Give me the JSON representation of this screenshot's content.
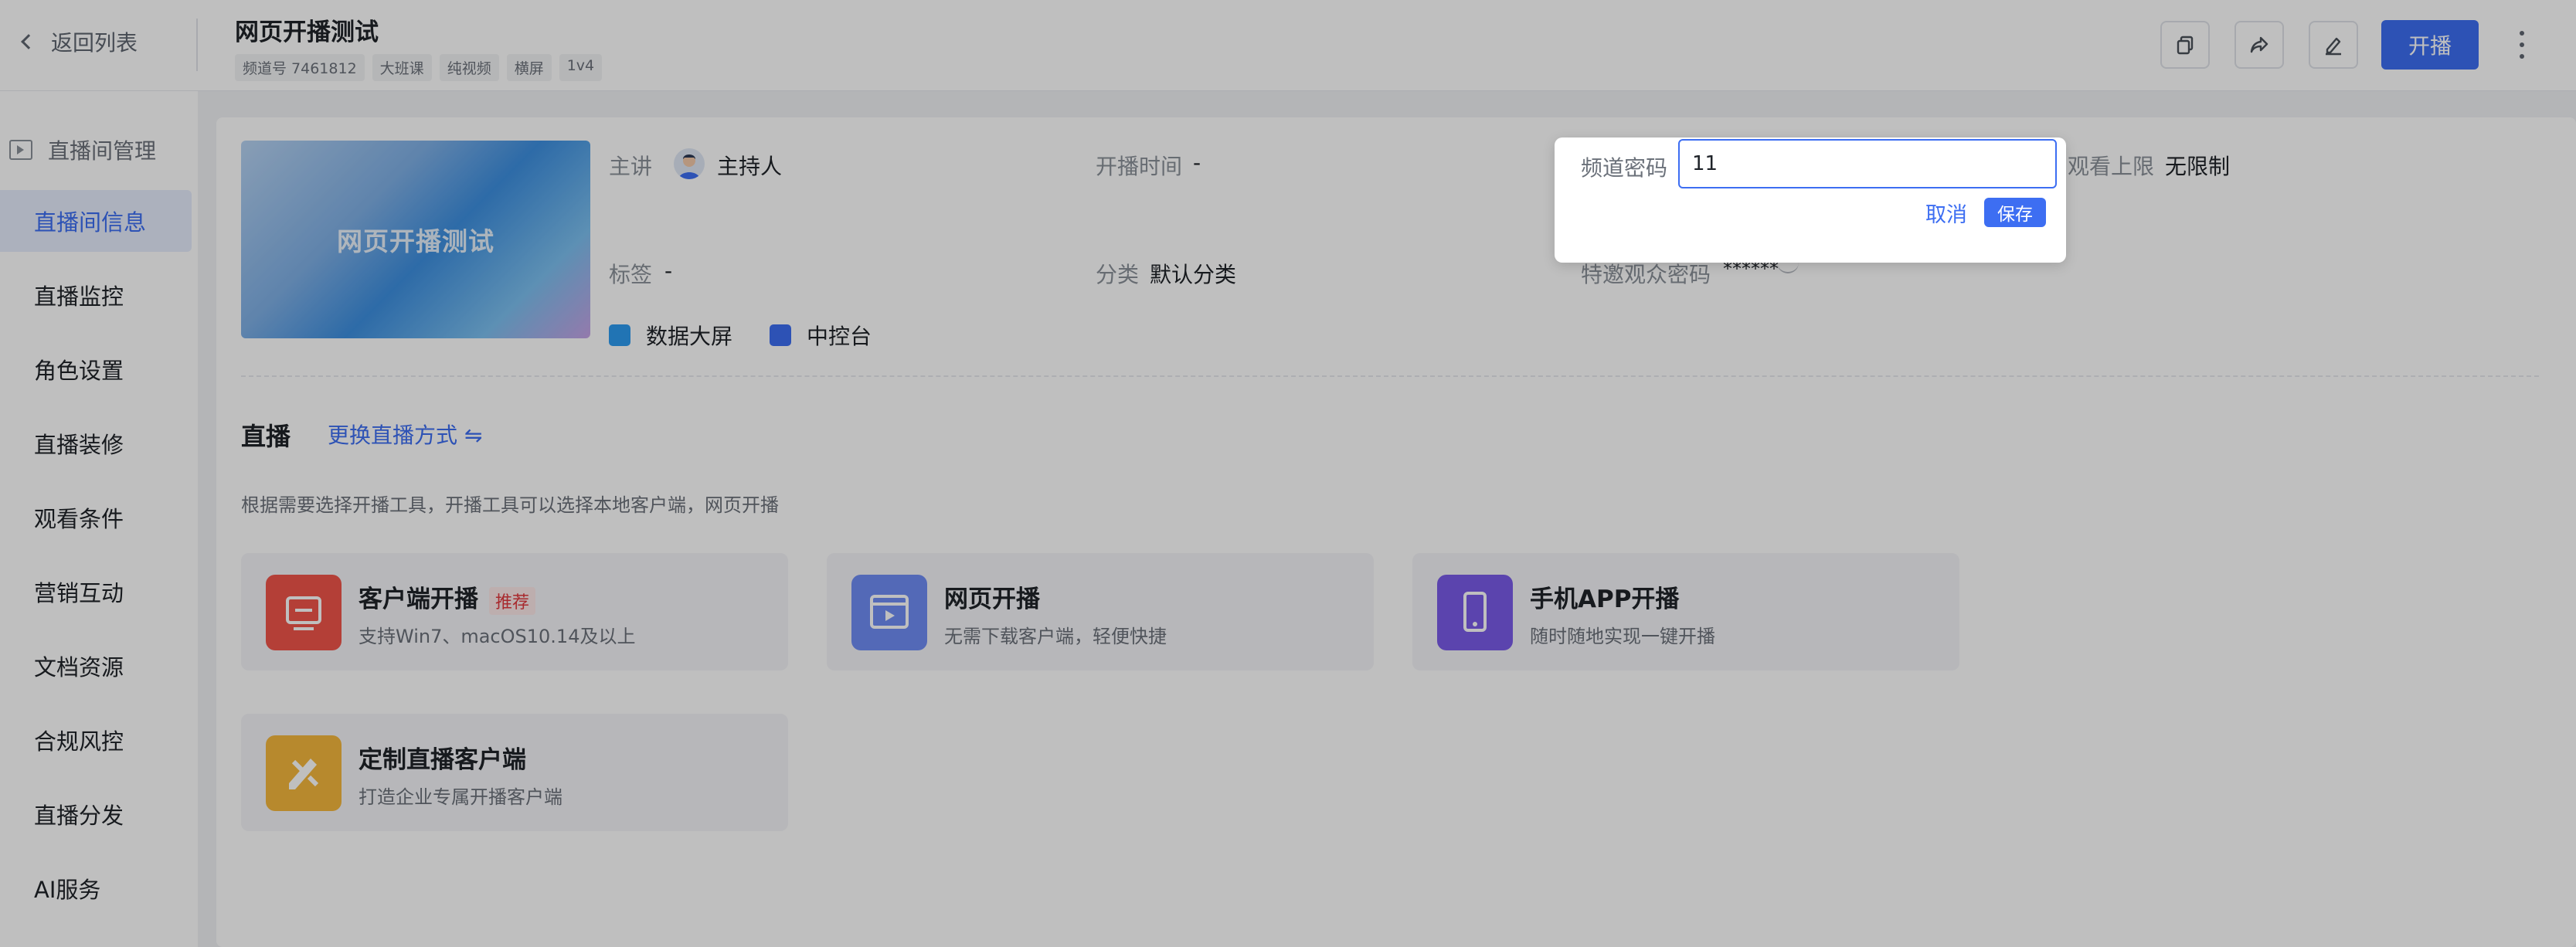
{
  "header": {
    "back_label": "返回列表",
    "title": "网页开播测试",
    "tags": [
      "频道号 7461812",
      "大班课",
      "纯视频",
      "横屏",
      "1v4"
    ],
    "start_label": "开播",
    "icons": [
      "copy-icon",
      "share-icon",
      "edit-icon",
      "more-icon"
    ]
  },
  "sidebar": {
    "section_title": "直播间管理",
    "items": [
      {
        "label": "直播间信息",
        "active": true
      },
      {
        "label": "直播监控"
      },
      {
        "label": "角色设置"
      },
      {
        "label": "直播装修"
      },
      {
        "label": "观看条件"
      },
      {
        "label": "营销互动"
      },
      {
        "label": "文档资源"
      },
      {
        "label": "合规风控"
      },
      {
        "label": "直播分发"
      },
      {
        "label": "AI服务"
      }
    ]
  },
  "info": {
    "thumbnail_text": "网页开播测试",
    "host_label": "主讲",
    "host_value": "主持人",
    "start_time_label": "开播时间",
    "start_time_value": "-",
    "view_limit_label": "观看上限",
    "view_limit_value": "无限制",
    "tags_label": "标签",
    "tags_value": "-",
    "category_label": "分类",
    "category_value": "默认分类",
    "guest_pwd_label": "特邀观众密码",
    "guest_pwd_value": "******",
    "tools": [
      "数据大屏",
      "中控台"
    ]
  },
  "live": {
    "section_title": "直播",
    "switch_label": "更换直播方式 ⇋",
    "description": "根据需要选择开播工具，开播工具可以选择本地客户端，网页开播",
    "cards": [
      {
        "name": "客户端开播",
        "badge": "推荐",
        "desc": "支持Win7、macOS10.14及以上",
        "color": "#f0554a"
      },
      {
        "name": "网页开播",
        "desc": "无需下载客户端，轻便快捷",
        "color": "#6f8df5"
      },
      {
        "name": "手机APP开播",
        "desc": "随时随地实现一键开播",
        "color": "#7a5be8"
      },
      {
        "name": "定制直播客户端",
        "desc": "打造企业专属开播客户端",
        "color": "#f5b73d"
      }
    ]
  },
  "popover": {
    "label": "频道密码",
    "value": "11",
    "cancel_label": "取消",
    "save_label": "保存"
  }
}
